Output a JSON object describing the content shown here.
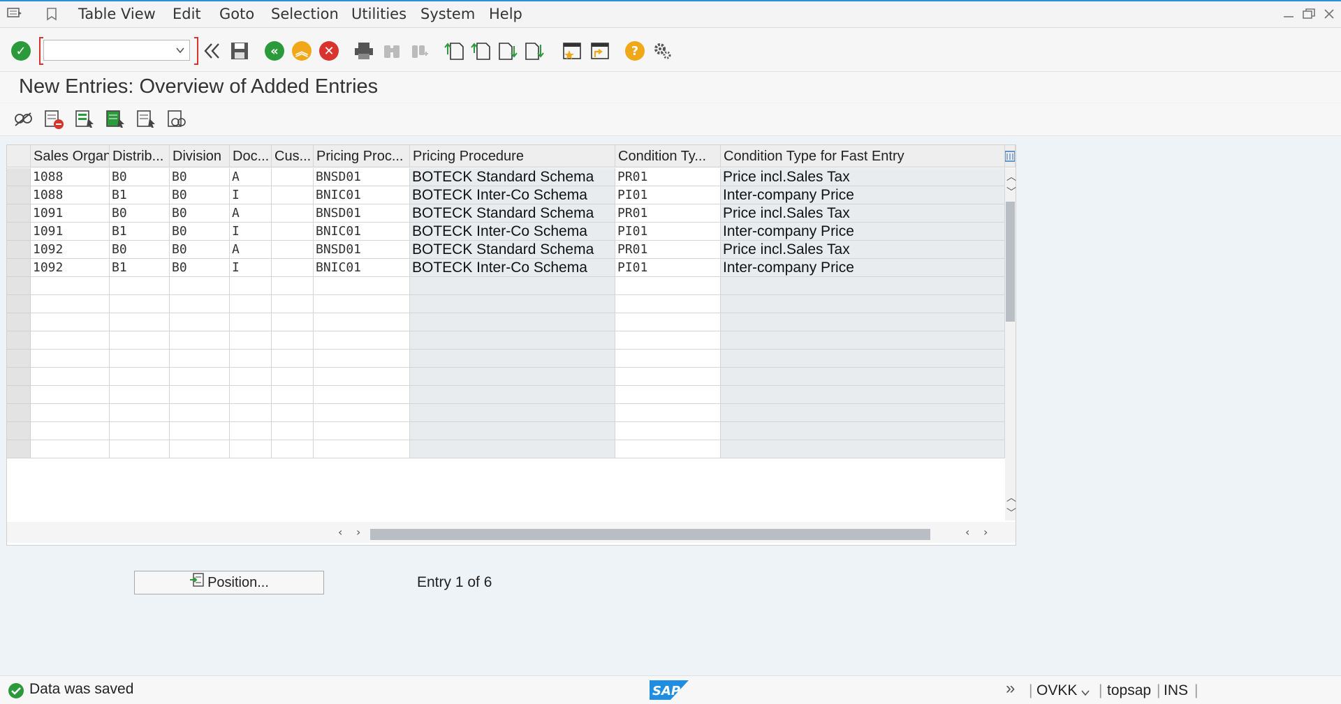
{
  "menu": {
    "items": [
      "Table View",
      "Edit",
      "Goto",
      "Selection",
      "Utilities",
      "System",
      "Help"
    ]
  },
  "toolbar": {
    "command_value": ""
  },
  "page": {
    "title": "New Entries: Overview of Added Entries"
  },
  "table": {
    "columns": [
      "Sales Organ...",
      "Distrib...",
      "Division",
      "Doc...",
      "Cus...",
      "Pricing Proc...",
      "Pricing Procedure",
      "Condition Ty...",
      "Condition Type for Fast Entry"
    ],
    "rows": [
      [
        "1088",
        "B0",
        "B0",
        "A",
        "",
        "BNSD01",
        "BOTECK Standard Schema",
        "PR01",
        "Price incl.Sales Tax"
      ],
      [
        "1088",
        "B1",
        "B0",
        "I",
        "",
        "BNIC01",
        "BOTECK Inter-Co Schema",
        "PI01",
        "Inter-company Price"
      ],
      [
        "1091",
        "B0",
        "B0",
        "A",
        "",
        "BNSD01",
        "BOTECK Standard Schema",
        "PR01",
        "Price incl.Sales Tax"
      ],
      [
        "1091",
        "B1",
        "B0",
        "I",
        "",
        "BNIC01",
        "BOTECK Inter-Co Schema",
        "PI01",
        "Inter-company Price"
      ],
      [
        "1092",
        "B0",
        "B0",
        "A",
        "",
        "BNSD01",
        "BOTECK Standard Schema",
        "PR01",
        "Price incl.Sales Tax"
      ],
      [
        "1092",
        "B1",
        "B0",
        "I",
        "",
        "BNIC01",
        "BOTECK Inter-Co Schema",
        "PI01",
        "Inter-company Price"
      ]
    ],
    "empty_rows": 10
  },
  "footer": {
    "position_label": "Position...",
    "entry_text": "Entry 1 of 6"
  },
  "status": {
    "message": "Data was saved",
    "transaction": "OVKK",
    "server": "topsap",
    "mode": "INS",
    "logo": "SAP"
  },
  "colors": {
    "accent": "#2b8fd6",
    "ok_green": "#2b9a3a",
    "cancel_red": "#d8332c",
    "warn_orange": "#f0a818"
  }
}
